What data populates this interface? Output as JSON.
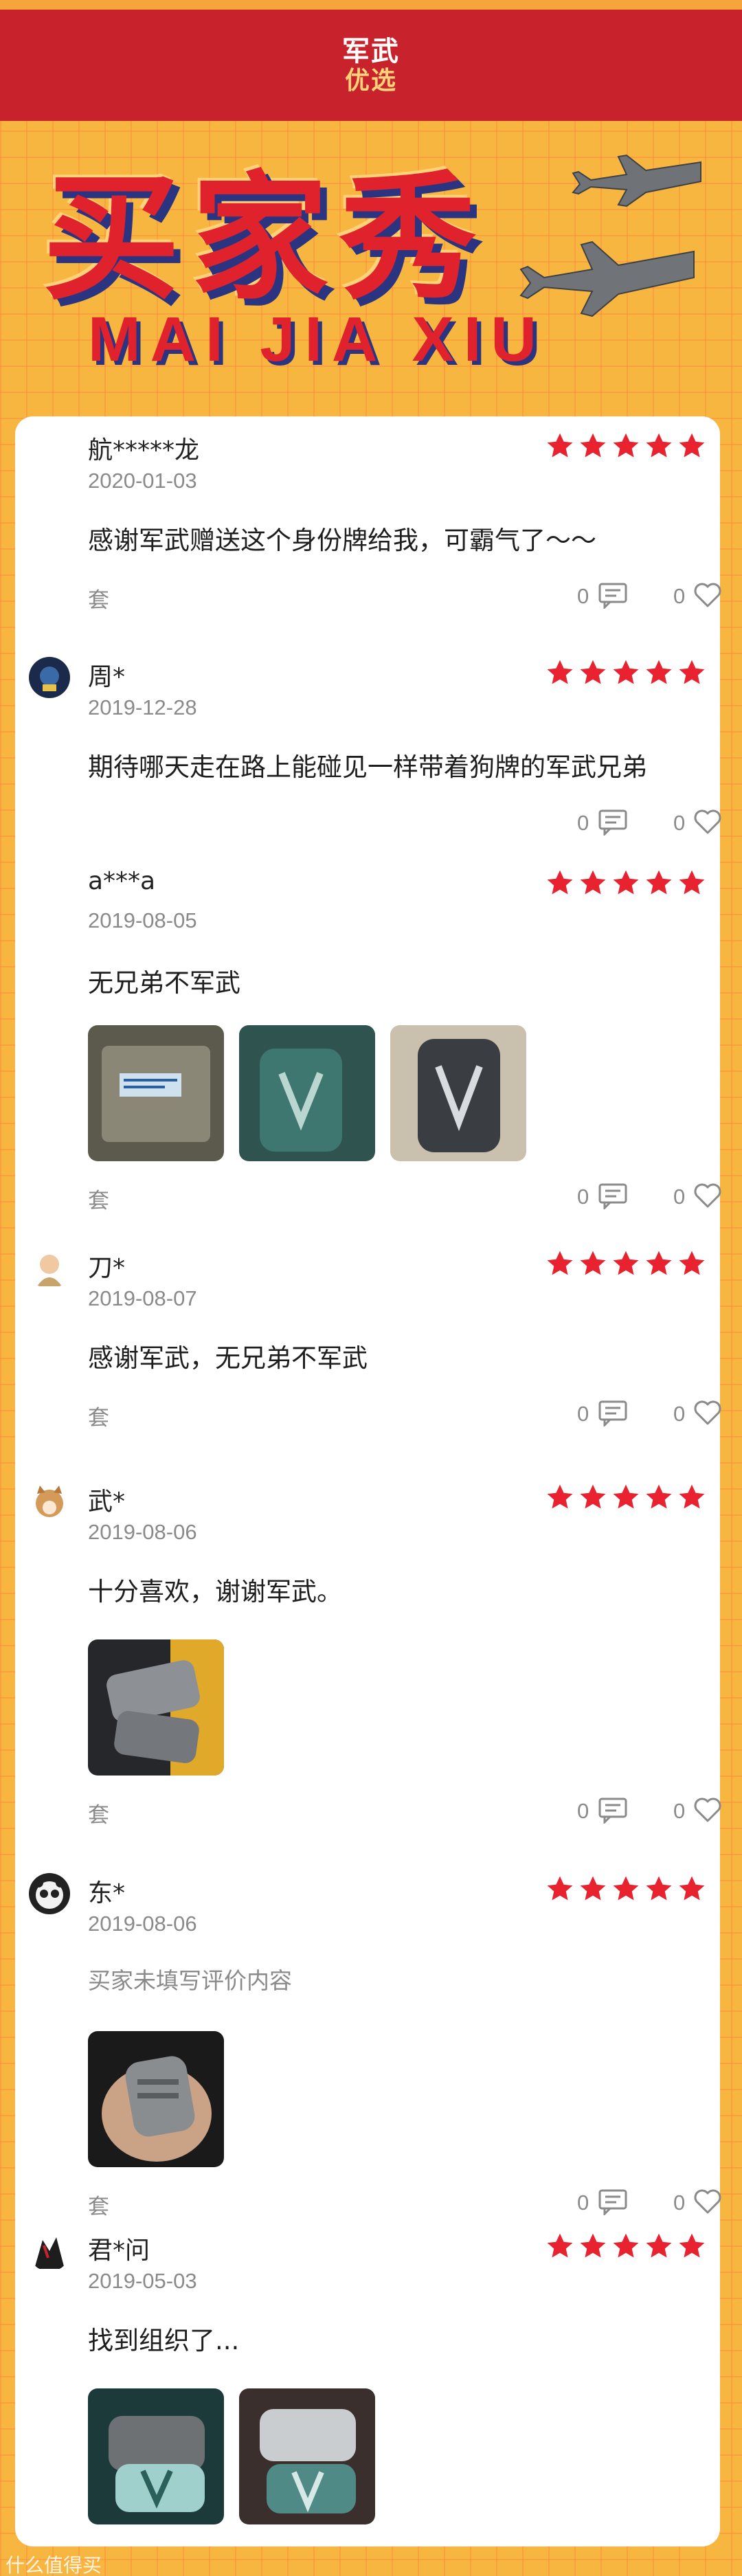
{
  "brand": {
    "line1": "军武",
    "line2": "优选"
  },
  "hero": {
    "title": "买家秀",
    "subtitle": "MAI JIA XIU"
  },
  "reviews": [
    {
      "user": "航*****龙",
      "date": "2020-01-03",
      "rating": 5,
      "text": "感谢军武赠送这个身份牌给我，可霸气了～～",
      "spec": "套",
      "comments": "0",
      "likes": "0"
    },
    {
      "user": "周*",
      "date": "2019-12-28",
      "rating": 5,
      "text": "期待哪天走在路上能碰见一样带着狗牌的军武兄弟",
      "spec": "",
      "comments": "0",
      "likes": "0"
    },
    {
      "user": "a***a",
      "date": "2019-08-05",
      "rating": 5,
      "text": "无兄弟不军武",
      "spec": "套",
      "comments": "0",
      "likes": "0"
    },
    {
      "user": "刀*",
      "date": "2019-08-07",
      "rating": 5,
      "text": "感谢军武，无兄弟不军武",
      "spec": "套",
      "comments": "0",
      "likes": "0"
    },
    {
      "user": "武*",
      "date": "2019-08-06",
      "rating": 5,
      "text": "十分喜欢，谢谢军武。",
      "spec": "套",
      "comments": "0",
      "likes": "0"
    },
    {
      "user": "东*",
      "date": "2019-08-06",
      "rating": 5,
      "text": "买家未填写评价内容",
      "spec": "套",
      "comments": "0",
      "likes": "0"
    },
    {
      "user": "君*问",
      "date": "2019-05-03",
      "rating": 5,
      "text": "找到组织了...",
      "spec": "",
      "comments": "",
      "likes": ""
    }
  ],
  "watermark": "什么值得买",
  "colors": {
    "accent": "#e0222c",
    "navy": "#2b3480",
    "background": "#f7b640",
    "bar": "#c8232c"
  },
  "icons": {
    "star": "star-icon",
    "comment": "comment-icon",
    "like": "heart-icon"
  }
}
